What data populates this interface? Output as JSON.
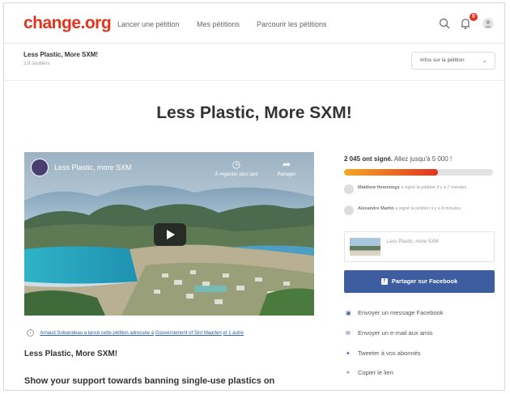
{
  "brand": {
    "logo": "change.org",
    "color": "#e4331d"
  },
  "nav": {
    "links": [
      "Lancer une pétition",
      "Mes pétitions",
      "Parcourir les pétitions"
    ],
    "notification_count": "0"
  },
  "subheader": {
    "title": "Less Plastic, More SXM!",
    "meta": "2,9 soutiens",
    "info_button": "Infos sur la pétition"
  },
  "petition": {
    "title": "Less Plastic, More SXM!"
  },
  "video": {
    "title": "Less Plastic, more SXM",
    "watch_later": "À regarder plus tard",
    "share": "Partager"
  },
  "signatures": {
    "count": "2 045 ont signé.",
    "goal": "Allez jusqu'à 5 000 !",
    "progress_fraction": 0.63,
    "progress_color_start": "#f5a623",
    "progress_color_end": "#e4331d"
  },
  "recent_signers": [
    {
      "name": "Matthew Hemmings",
      "action": "a signé la pétition il y a 7 minutes"
    },
    {
      "name": "Alexandre Martin",
      "action": "a signé la pétition il y a 8 minutes"
    }
  ],
  "share_card": {
    "caption": "Less Plastic, more SXM"
  },
  "share": {
    "facebook_button": "Partager sur Facebook",
    "facebook_color": "#3d5da0",
    "options": [
      {
        "icon": "messenger-icon",
        "label": "Envoyer un message Facebook"
      },
      {
        "icon": "mail-icon",
        "label": "Envoyer un e-mail aux amis"
      },
      {
        "icon": "twitter-icon",
        "label": "Tweeter à vos abonnés"
      },
      {
        "icon": "link-icon",
        "label": "Copier le lien"
      }
    ]
  },
  "notice": {
    "prefix": "Arnaud Solvandeau a lancé cette pétition adressée à",
    "target": "Gouvernement of Sint Maarten",
    "suffix": "et 1 autre"
  },
  "body": {
    "title": "Less Plastic, More SXM!",
    "heading": "Show your support towards banning single-use plastics on"
  }
}
